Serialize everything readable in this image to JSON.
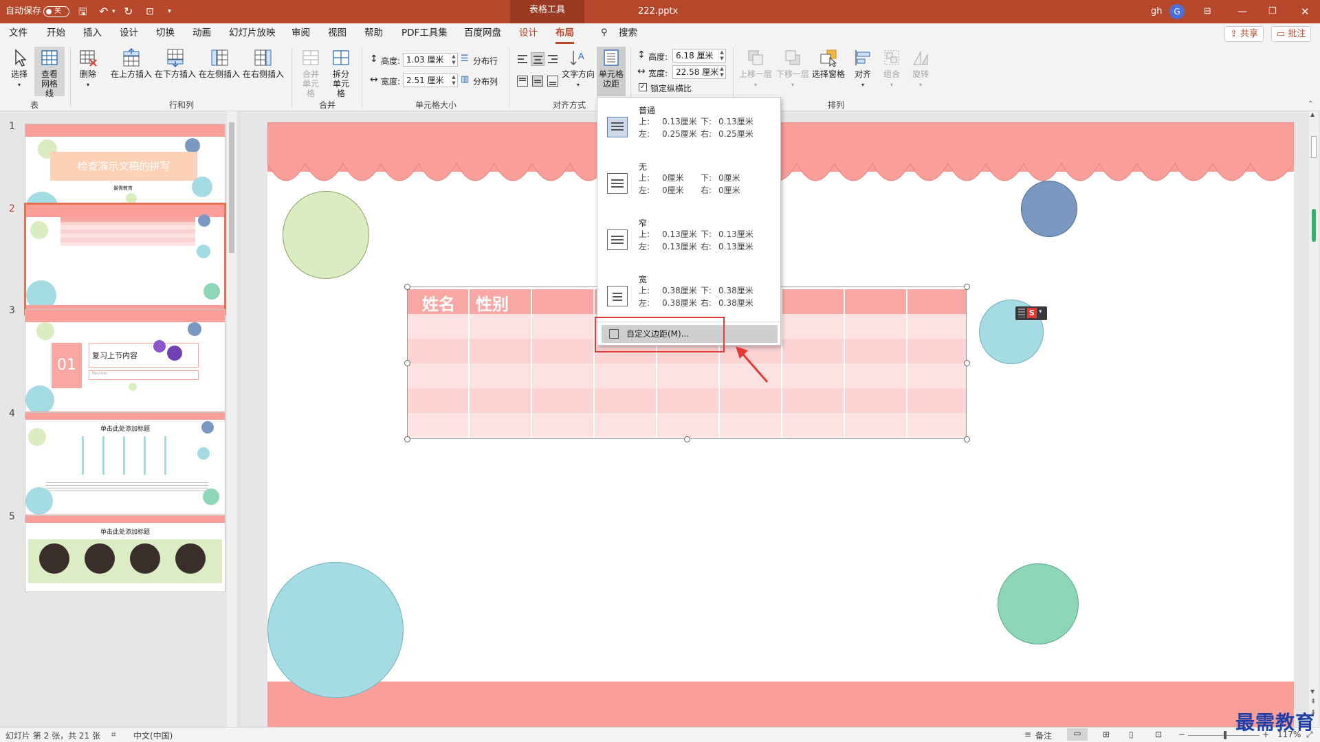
{
  "titlebar": {
    "autosave_label": "自动保存",
    "autosave_state": "关",
    "context_tab": "表格工具",
    "filename": "222.pptx",
    "user": "gh",
    "avatar_initial": "G"
  },
  "menu": {
    "tabs": [
      "文件",
      "开始",
      "插入",
      "设计",
      "切换",
      "动画",
      "幻灯片放映",
      "审阅",
      "视图",
      "帮助",
      "PDF工具集",
      "百度网盘",
      "设计",
      "布局"
    ],
    "active_tab": "布局",
    "search_label": "搜索",
    "share_label": "共享",
    "comment_label": "批注"
  },
  "ribbon": {
    "table_group": {
      "label": "表",
      "select": "选择",
      "gridlines": "查看网格线"
    },
    "rows_cols_group": {
      "label": "行和列",
      "delete": "删除",
      "insert_above": "在上方插入",
      "insert_below": "在下方插入",
      "insert_left": "在左侧插入",
      "insert_right": "在右侧插入"
    },
    "merge_group": {
      "label": "合并",
      "merge_cells": "合并单元格",
      "split_cells": "拆分单元格"
    },
    "cell_size_group": {
      "label": "单元格大小",
      "height_label": "高度:",
      "height_value": "1.03 厘米",
      "width_label": "宽度:",
      "width_value": "2.51 厘米",
      "distribute_rows": "分布行",
      "distribute_cols": "分布列"
    },
    "alignment_group": {
      "label": "对齐方式",
      "text_direction": "文字方向",
      "cell_margins": "单元格边距"
    },
    "table_size": {
      "height_label": "高度:",
      "height_value": "6.18 厘米",
      "width_label": "宽度:",
      "width_value": "22.58 厘米",
      "lock_ratio": "锁定纵横比"
    },
    "arrange_group": {
      "label": "排列",
      "bring_forward": "上移一层",
      "send_backward": "下移一层",
      "selection_pane": "选择窗格",
      "align": "对齐",
      "group": "组合",
      "rotate": "旋转"
    }
  },
  "dropdown": {
    "options": [
      {
        "name": "普通",
        "top_label": "上:",
        "top": "0.13厘米",
        "bottom_label": "下:",
        "bottom": "0.13厘米",
        "left_label": "左:",
        "left": "0.25厘米",
        "right_label": "右:",
        "right": "0.25厘米"
      },
      {
        "name": "无",
        "top_label": "上:",
        "top": "0厘米",
        "bottom_label": "下:",
        "bottom": "0厘米",
        "left_label": "左:",
        "left": "0厘米",
        "right_label": "右:",
        "right": "0厘米"
      },
      {
        "name": "窄",
        "top_label": "上:",
        "top": "0.13厘米",
        "bottom_label": "下:",
        "bottom": "0.13厘米",
        "left_label": "左:",
        "left": "0.13厘米",
        "right_label": "右:",
        "right": "0.13厘米"
      },
      {
        "name": "宽",
        "top_label": "上:",
        "top": "0.38厘米",
        "bottom_label": "下:",
        "bottom": "0.38厘米",
        "left_label": "左:",
        "left": "0.38厘米",
        "right_label": "右:",
        "right": "0.38厘米"
      }
    ],
    "custom": "自定义边距(M)..."
  },
  "thumbnails": {
    "numbers": [
      "1",
      "2",
      "3",
      "4",
      "5"
    ],
    "selected": "2",
    "slide1_title": "检查演示文稿的拼写",
    "slide1_sub": "最需教育",
    "slide3_num": "01",
    "slide3_title": "复习上节内容",
    "slide3_review": "Review",
    "slide4_title": "单击此处添加标题",
    "slide5_title": "单击此处添加标题"
  },
  "slide": {
    "header_cells": [
      "姓名",
      "性别"
    ]
  },
  "statusbar": {
    "slide_info": "幻灯片 第 2 张，共 21 张",
    "language": "中文(中国)",
    "notes": "备注",
    "zoom": "117%"
  },
  "watermark": "最需教育",
  "colors": {
    "accent": "#b7472a",
    "slide_pink": "#fa9e9a",
    "table_header": "#f8a7a4",
    "table_row_a": "#fde2e2",
    "table_row_b": "#fbd3d3",
    "green_circle": "#dbecc0",
    "blue_circle": "#7b98c2",
    "teal_circle": "#a5dbe3",
    "mint_circle": "#8ed6b8"
  }
}
